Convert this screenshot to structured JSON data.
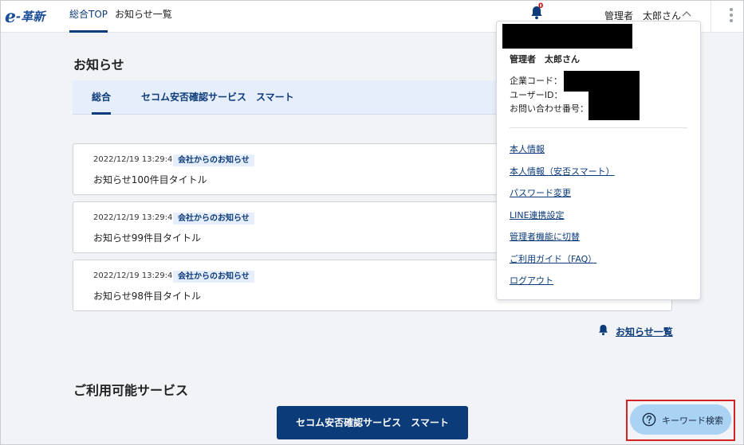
{
  "header": {
    "logo_text": "e-革新",
    "nav": [
      {
        "label": "総合TOP",
        "active": true
      },
      {
        "label": "お知らせ一覧",
        "active": false
      }
    ],
    "notification_count": "0",
    "user_label": "管理者　太郎さん"
  },
  "notices": {
    "title": "お知らせ",
    "tabs": [
      {
        "label": "総合",
        "active": true
      },
      {
        "label": "セコム安否確認サービス　スマート",
        "active": false
      }
    ],
    "items": [
      {
        "date": "2022/12/19 13:29:46",
        "tag": "会社からのお知らせ",
        "title": "お知らせ100件目タイトル"
      },
      {
        "date": "2022/12/19 13:29:46",
        "tag": "会社からのお知らせ",
        "title": "お知らせ99件目タイトル"
      },
      {
        "date": "2022/12/19 13:29:46",
        "tag": "会社からのお知らせ",
        "title": "お知らせ98件目タイトル"
      }
    ],
    "all_link": "お知らせ一覧"
  },
  "services": {
    "title": "ご利用可能サービス",
    "button": "セコム安否確認サービス　スマート"
  },
  "user_menu": {
    "user": "管理者　太郎さん",
    "company_code_label": "企業コード：",
    "user_id_label": "ユーザーID：",
    "inquiry_label": "お問い合わせ番号：",
    "items": [
      "本人情報",
      "本人情報（安否スマート）",
      "パスワード変更",
      "LINE連携設定",
      "管理者機能に切替",
      "ご利用ガイド（FAQ）",
      "ログアウト"
    ]
  },
  "keyword_search": {
    "label": "キーワード検索"
  },
  "colors": {
    "primary": "#0c3b7a",
    "tab_background": "#e5eefa",
    "page_background": "#f1f3f6",
    "badge": "#d00000",
    "search_button": "#a9d2f3",
    "highlight": "#d32222"
  },
  "icons": [
    "bell-icon",
    "chevron-up-icon",
    "more-vertical-icon",
    "question-circle-icon"
  ]
}
